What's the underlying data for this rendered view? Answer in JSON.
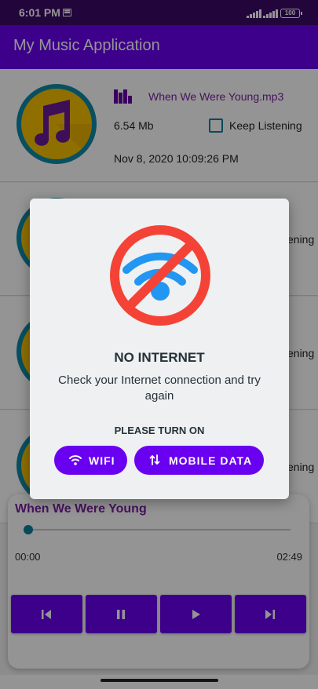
{
  "status_bar": {
    "time": "6:01 PM",
    "battery": "100"
  },
  "app_bar": {
    "title": "My Music Application"
  },
  "songs": [
    {
      "name": "When We Were Young.mp3",
      "size": "6.54 Mb",
      "keep_label": "Keep Listening",
      "date": "Nov 8, 2020 10:09:26 PM"
    },
    {
      "keep_label": "ening"
    },
    {
      "keep_label": "ening"
    },
    {
      "keep_label": "ening"
    }
  ],
  "player": {
    "title": "When We Were Young",
    "current_time": "00:00",
    "total_time": "02:49",
    "progress": 0
  },
  "dialog": {
    "title": "NO INTERNET",
    "message": "Check your Internet connection and try again",
    "prompt": "PLEASE TURN ON",
    "wifi_button": "WIFI",
    "mobile_data_button": "MOBILE DATA"
  },
  "colors": {
    "primary": "#6a00f0",
    "status_bar": "#3a0a66",
    "accent_teal": "#0f7f9c",
    "album_yellow": "#f6c000",
    "song_text": "#7b1fa2",
    "no_wifi_red": "#f44336",
    "wifi_blue": "#2196f3"
  },
  "icons": [
    "notification-icon",
    "signal-icon",
    "battery-icon",
    "music-notes-icon",
    "equalizer-icon",
    "no-wifi-icon",
    "wifi-icon",
    "swap-vertical-icon",
    "skip-previous-icon",
    "pause-icon",
    "play-icon",
    "skip-next-icon"
  ]
}
